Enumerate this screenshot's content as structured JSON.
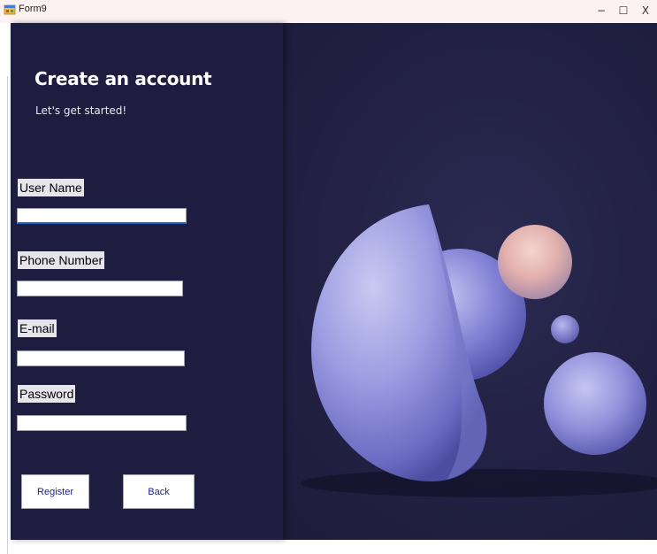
{
  "window": {
    "title": "Form9",
    "minimize_glyph": "−",
    "maximize_glyph": "☐",
    "close_glyph": "X"
  },
  "header": {
    "title": "Create an account",
    "subtitle": "Let's get started!"
  },
  "form": {
    "username": {
      "label": "User Name",
      "value": ""
    },
    "phone": {
      "label": "Phone Number",
      "value": ""
    },
    "email": {
      "label": "E-mail",
      "value": ""
    },
    "password": {
      "label": "Password",
      "value": ""
    }
  },
  "buttons": {
    "register": "Register",
    "back": "Back"
  },
  "colors": {
    "panel_bg": "#1f1d3f",
    "sphere_lavender": "#8f8fdc",
    "sphere_pink": "#e8b7b4",
    "button_text": "#1b1f8a"
  },
  "icons": {
    "app_icon": "winforms-app-icon"
  }
}
